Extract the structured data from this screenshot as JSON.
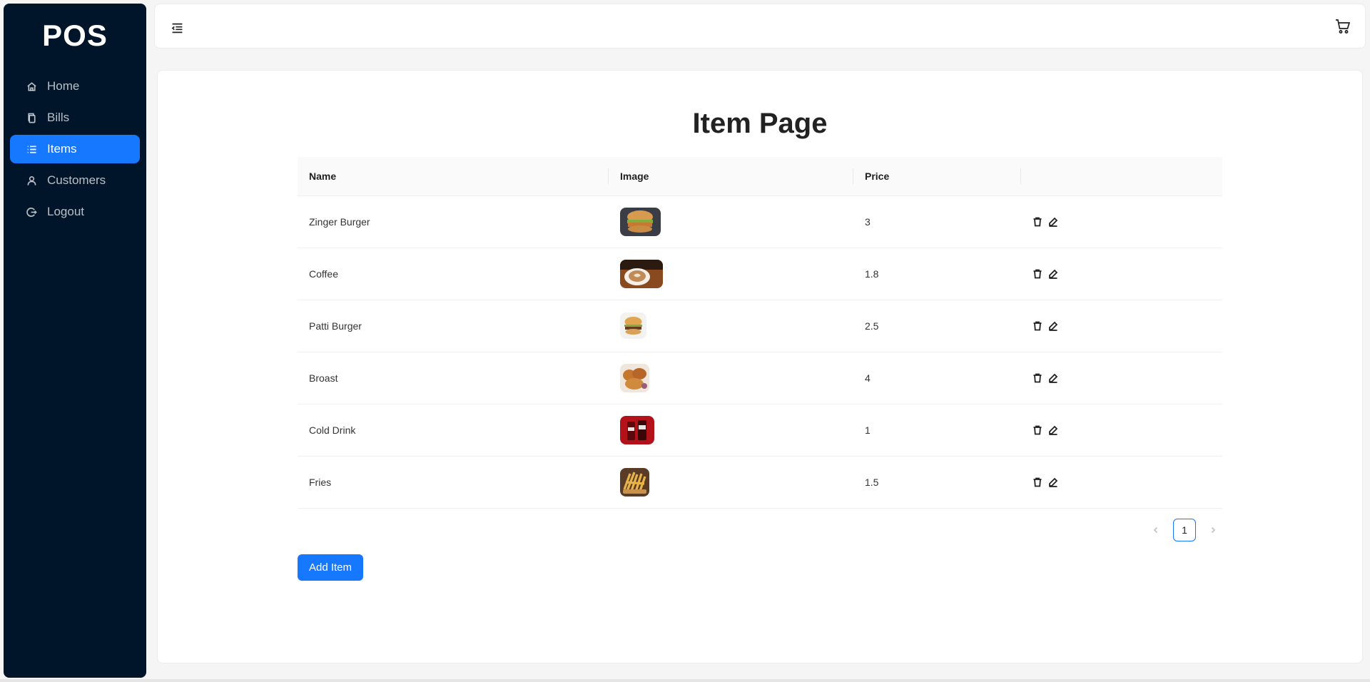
{
  "app": {
    "logo": "POS"
  },
  "sidebar": {
    "items": [
      {
        "label": "Home",
        "icon": "home-icon",
        "active": false
      },
      {
        "label": "Bills",
        "icon": "copy-icon",
        "active": false
      },
      {
        "label": "Items",
        "icon": "list-icon",
        "active": true
      },
      {
        "label": "Customers",
        "icon": "user-icon",
        "active": false
      },
      {
        "label": "Logout",
        "icon": "logout-icon",
        "active": false
      }
    ]
  },
  "header": {
    "toggle_icon": "menu-fold-icon",
    "cart_icon": "cart-icon"
  },
  "main": {
    "title": "Item Page",
    "table": {
      "columns": [
        "Name",
        "Image",
        "Price",
        ""
      ],
      "rows": [
        {
          "name": "Zinger Burger",
          "price": "3",
          "image": "zinger-burger"
        },
        {
          "name": "Coffee",
          "price": "1.8",
          "image": "coffee"
        },
        {
          "name": "Patti Burger",
          "price": "2.5",
          "image": "patti-burger"
        },
        {
          "name": "Broast",
          "price": "4",
          "image": "broast"
        },
        {
          "name": "Cold Drink",
          "price": "1",
          "image": "cold-drink"
        },
        {
          "name": "Fries",
          "price": "1.5",
          "image": "fries"
        }
      ]
    },
    "pagination": {
      "current": "1"
    },
    "add_button_label": "Add Item"
  },
  "colors": {
    "sidebar_bg": "#001529",
    "accent": "#1677ff",
    "page_bg": "#f5f5f5"
  }
}
